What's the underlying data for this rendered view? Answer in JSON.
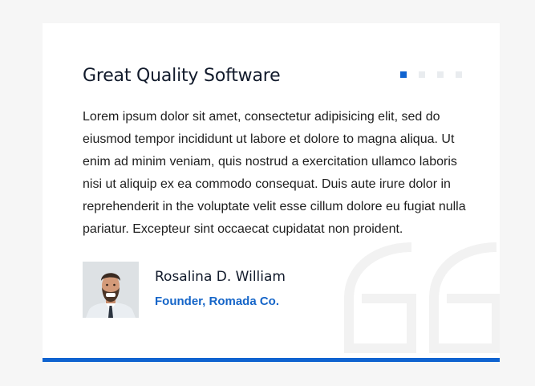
{
  "testimonial": {
    "title": "Great Quality Software",
    "body": "Lorem ipsum dolor sit amet, consectetur adipisicing elit, sed do eiusmod tempor incididunt ut labore et dolore to magna aliqua. Ut enim ad minim veniam, quis nostrud a exercitation ullamco laboris nisi ut aliquip ex ea commodo consequat. Duis aute irure dolor in reprehenderit in the voluptate velit esse cillum dolore eu fugiat nulla pariatur. Excepteur sint occaecat cupidatat non proident.",
    "author_name": "Rosalina D. William",
    "author_role": "Founder, Romada Co.",
    "quote_icon": "quote-icon",
    "avatar_icon": "avatar-photo"
  },
  "slider": {
    "total": 4,
    "active_index": 0
  },
  "colors": {
    "accent": "#0f63d0",
    "role_text": "#1565c8",
    "title_text": "#111a2b",
    "inactive_dot": "#e9ecef",
    "quote_mark": "#f3f3f3",
    "page_bg": "#f6f6f6"
  }
}
